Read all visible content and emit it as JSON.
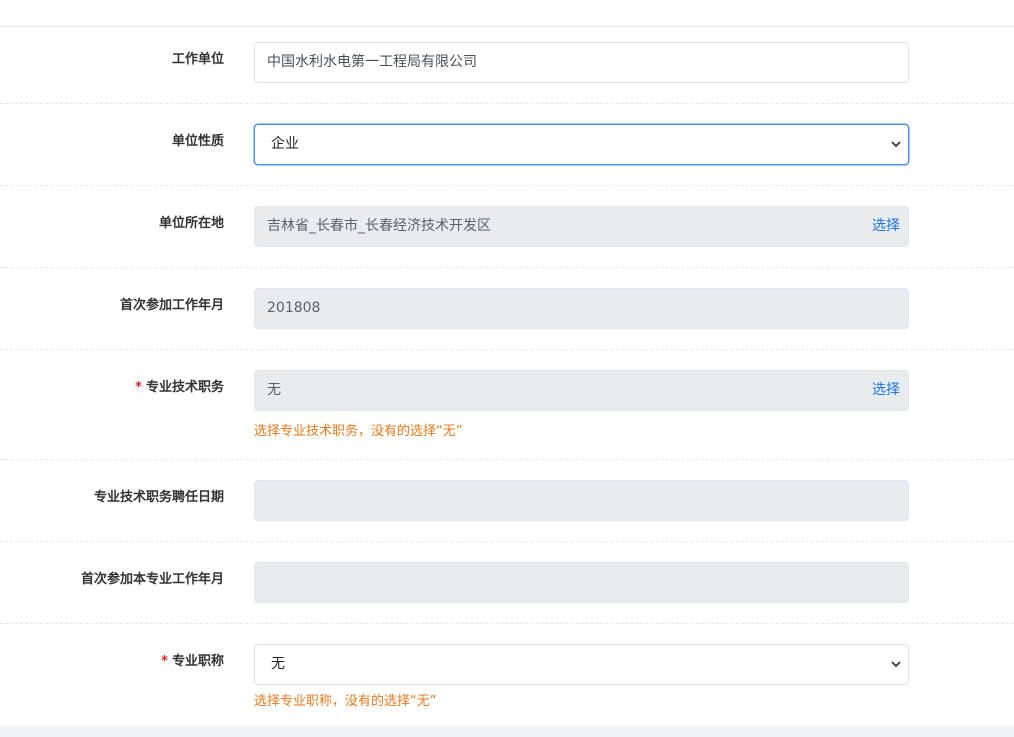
{
  "form": {
    "work_unit": {
      "label": "工作单位",
      "value": "中国水利水电第一工程局有限公司"
    },
    "unit_nature": {
      "label": "单位性质",
      "selected": "企业"
    },
    "unit_location": {
      "label": "单位所在地",
      "value": "吉林省_长春市_长春经济技术开发区",
      "pick_label": "选择"
    },
    "first_work_month": {
      "label": "首次参加工作年月",
      "value": "201808"
    },
    "professional_title_duty": {
      "required_mark": "*",
      "label": "专业技术职务",
      "value": "无",
      "pick_label": "选择",
      "hint": "选择专业技术职务，没有的选择“无”"
    },
    "duty_appoint_date": {
      "label": "专业技术职务聘任日期",
      "value": ""
    },
    "first_professional_work_month": {
      "label": "首次参加本专业工作年月",
      "value": ""
    },
    "professional_title": {
      "required_mark": "*",
      "label": "专业职称",
      "selected": "无",
      "hint": "选择专业职称，没有的选择“无”"
    }
  },
  "icons": {
    "select_arrow": "chevron-down-icon"
  },
  "colors": {
    "accent": "#4a8ef0",
    "link": "#1a73e8",
    "hint": "#e67a1e",
    "required": "#e02020",
    "readonly_bg": "#e9ecef"
  }
}
